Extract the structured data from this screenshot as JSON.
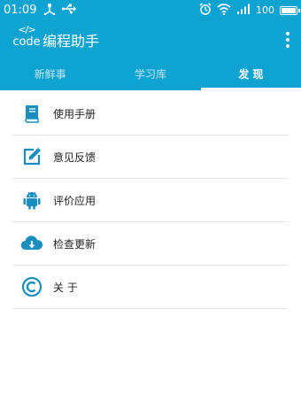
{
  "status_bar": {
    "time": "01:09",
    "battery_level": "100",
    "icons": [
      "usb-icon",
      "usb-debug-icon",
      "alarm-icon",
      "wifi-icon",
      "signal-icon",
      "battery-icon"
    ]
  },
  "app": {
    "logo_tag": "</>",
    "logo_text": "code",
    "title": "编程助手"
  },
  "tabs": [
    {
      "label": "新鲜事",
      "active": false
    },
    {
      "label": "学习库",
      "active": false
    },
    {
      "label": "发 现",
      "active": true
    }
  ],
  "menu": [
    {
      "label": "使用手册",
      "icon": "book-icon"
    },
    {
      "label": "意见反馈",
      "icon": "edit-icon"
    },
    {
      "label": "评价应用",
      "icon": "android-icon"
    },
    {
      "label": "检查更新",
      "icon": "cloud-download-icon"
    },
    {
      "label": "关 于",
      "icon": "copyright-icon"
    }
  ],
  "colors": {
    "primary": "#0fa3d2",
    "icon": "#1a8fbf",
    "divider": "#e6e6e6",
    "text": "#222222"
  }
}
